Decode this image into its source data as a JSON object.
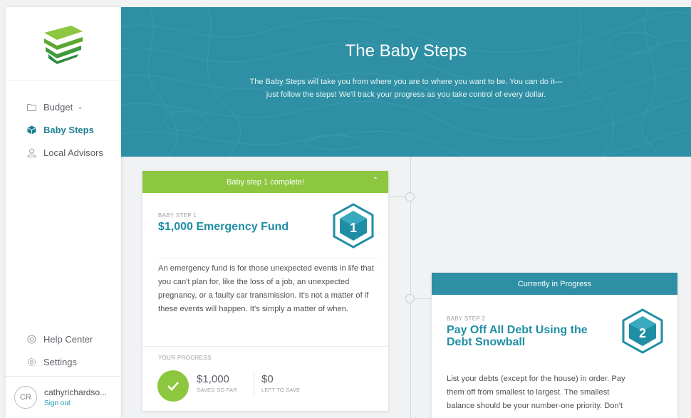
{
  "sidebar": {
    "nav": [
      {
        "label": "Budget",
        "icon": "folder-icon"
      },
      {
        "label": "Baby Steps",
        "icon": "cube-icon"
      },
      {
        "label": "Local Advisors",
        "icon": "person-icon"
      }
    ],
    "bottom": [
      {
        "label": "Help Center",
        "icon": "lifebuoy-icon"
      },
      {
        "label": "Settings",
        "icon": "gear-icon"
      }
    ],
    "user": {
      "initials": "CR",
      "name": "cathyrichardso...",
      "signout": "Sign out"
    }
  },
  "header": {
    "title": "The Baby Steps",
    "subtitle_line1": "The Baby Steps will take you from where you are to where you want to be. You can do it—",
    "subtitle_line2": "just follow the steps! We'll track your progress as you take control of every dollar."
  },
  "step1": {
    "banner": "Baby step 1 complete!",
    "label": "BABY STEP 1",
    "title": "$1,000 Emergency Fund",
    "badge": "1",
    "description": "An emergency fund is for those unexpected events in life that you can't plan for, like the loss of a job, an unexpected pregnancy, or a faulty car transmission. It's not a matter of if these events will happen. It's simply a matter of when.",
    "progress_label": "YOUR PROGRESS",
    "saved_amount": "$1,000",
    "saved_label": "SAVED SO FAR",
    "left_amount": "$0",
    "left_label": "LEFT TO SAVE"
  },
  "step2": {
    "banner": "Currently in Progress",
    "label": "BABY STEP 2",
    "title_line1": "Pay Off All Debt Using the",
    "title_line2": "Debt Snowball",
    "badge": "2",
    "desc_line1": "List your debts (except for the house) in order. Pay",
    "desc_line2": "them off from smallest to largest. The smallest",
    "desc_line3": "balance should be your number-one priority. Don't"
  },
  "colors": {
    "teal": "#2f8fa4",
    "green": "#8dc63f",
    "badge": "#1f8ea4"
  }
}
